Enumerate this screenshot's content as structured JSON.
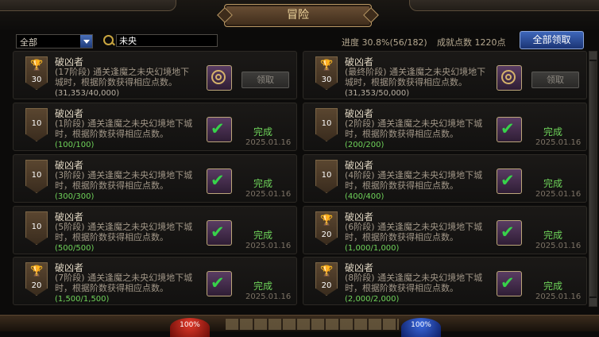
{
  "header": {
    "title": "冒险"
  },
  "filter": {
    "category": "全部",
    "search_value": "未央"
  },
  "stats": {
    "progress_label": "进度",
    "progress_value": "30.8%(56/182)",
    "points_label": "成就点数",
    "points_value": "1220点"
  },
  "claim_all_label": "全部领取",
  "cards": [
    {
      "title": "破凶者",
      "desc": "(17阶段) 通关逢魔之未央幻境地下城时，根据阶数获得相应点数。",
      "progress": "(31,353/40,000)",
      "points": "30",
      "trophy": true,
      "completed": false,
      "action": "领取",
      "date": ""
    },
    {
      "title": "破凶者",
      "desc": "(最终阶段) 通关逢魔之未央幻境地下城时，根据阶数获得相应点数。",
      "progress": "(31,353/50,000)",
      "points": "30",
      "trophy": true,
      "completed": false,
      "action": "领取",
      "date": ""
    },
    {
      "title": "破凶者",
      "desc": "(1阶段) 通关逢魔之未央幻境地下城时，根据阶数获得相应点数。",
      "progress": "(100/100)",
      "points": "10",
      "trophy": false,
      "completed": true,
      "action": "完成",
      "date": "2025.01.16"
    },
    {
      "title": "破凶者",
      "desc": "(2阶段) 通关逢魔之未央幻境地下城时，根据阶数获得相应点数。",
      "progress": "(200/200)",
      "points": "10",
      "trophy": false,
      "completed": true,
      "action": "完成",
      "date": "2025.01.16"
    },
    {
      "title": "破凶者",
      "desc": "(3阶段) 通关逢魔之未央幻境地下城时，根据阶数获得相应点数。",
      "progress": "(300/300)",
      "points": "10",
      "trophy": false,
      "completed": true,
      "action": "完成",
      "date": "2025.01.16"
    },
    {
      "title": "破凶者",
      "desc": "(4阶段) 通关逢魔之未央幻境地下城时，根据阶数获得相应点数。",
      "progress": "(400/400)",
      "points": "10",
      "trophy": false,
      "completed": true,
      "action": "完成",
      "date": "2025.01.16"
    },
    {
      "title": "破凶者",
      "desc": "(5阶段) 通关逢魔之未央幻境地下城时，根据阶数获得相应点数。",
      "progress": "(500/500)",
      "points": "10",
      "trophy": false,
      "completed": true,
      "action": "完成",
      "date": "2025.01.16"
    },
    {
      "title": "破凶者",
      "desc": "(6阶段) 通关逢魔之未央幻境地下城时，根据阶数获得相应点数。",
      "progress": "(1,000/1,000)",
      "points": "20",
      "trophy": true,
      "completed": true,
      "action": "完成",
      "date": "2025.01.16"
    },
    {
      "title": "破凶者",
      "desc": "(7阶段) 通关逢魔之未央幻境地下城时，根据阶数获得相应点数。",
      "progress": "(1,500/1,500)",
      "points": "20",
      "trophy": true,
      "completed": true,
      "action": "完成",
      "date": "2025.01.16"
    },
    {
      "title": "破凶者",
      "desc": "(8阶段) 通关逢魔之未央幻境地下城时，根据阶数获得相应点数。",
      "progress": "(2,000/2,000)",
      "points": "20",
      "trophy": true,
      "completed": true,
      "action": "完成",
      "date": "2025.01.16"
    }
  ],
  "hud": {
    "hp_label": "100%",
    "mp_label": "100%"
  },
  "colors": {
    "completed_green": "#6ed35a",
    "accent_gold": "#b89764",
    "claim_blue": "#2a4a98"
  }
}
